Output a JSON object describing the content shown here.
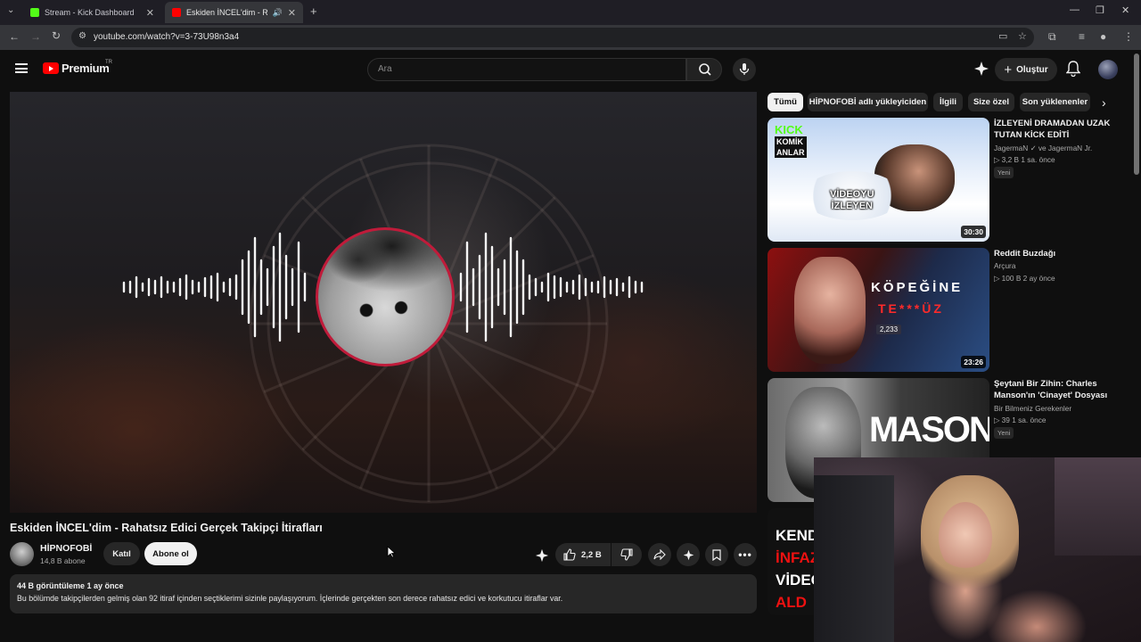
{
  "browser": {
    "tabs": [
      {
        "title": "Stream - Kick Dashboard",
        "favicon_color": "#53fc18"
      },
      {
        "title": "Eskiden İNCEL'dim - Rahatsız Edici Gerçek Takipçi İtirafları",
        "favicon_color": "#ff0000"
      }
    ],
    "url": "youtube.com/watch?v=3-73U98n3a4"
  },
  "header": {
    "logo_text": "Premium",
    "country_code": "TR",
    "search_placeholder": "Ara",
    "create_label": "Oluştur"
  },
  "video": {
    "title": "Eskiden İNCEL'dim - Rahatsız Edici Gerçek Takipçi İtirafları",
    "channel_name": "HİPNOFOBİ",
    "subscribers": "14,8 B abone",
    "join_label": "Katıl",
    "subscribe_label": "Abone ol",
    "like_count": "2,2 B",
    "views_date": "44 B görüntüleme  1 ay önce",
    "description": "Bu bölümde takipçilerden gelmiş olan 92 itiraf içinden seçtiklerimi sizinle paylaşıyorum. İçlerinde gerçekten son derece rahatsız edici ve korkutucu itiraflar var."
  },
  "chips": [
    "Tümü",
    "HİPNOFOBİ adlı yükleyiciden",
    "İlgili",
    "Size özel",
    "Son yüklenenler"
  ],
  "recommendations": [
    {
      "title": "İZLEYENİ DRAMADAN UZAK TUTAN KİCK EDİTİ",
      "channel": "JagermaN ✓ ve JagermaN Jr.",
      "meta": "▷ 3,2 B  1 sa. önce",
      "badge": "Yeni",
      "duration": "30:30",
      "thumb_text_1": "KICK",
      "thumb_text_2": "KOMİK",
      "thumb_text_3": "ANLAR",
      "thumb_text_4": "VİDEOYU",
      "thumb_text_5": "İZLEYEN"
    },
    {
      "title": "Reddit Buzdağı",
      "channel": "Arçura",
      "meta": "▷ 100 B  2 ay önce",
      "duration": "23:26",
      "thumb_text_1": "KÖPEĞİNE",
      "thumb_text_2": "TE***ÜZ",
      "thumb_text_3": "2,233"
    },
    {
      "title": "Şeytani Bir Zihin: Charles Manson'ın 'Cinayet' Dosyası",
      "channel": "Bir Bilmeniz Gerekenler",
      "meta": "▷ 39  1 sa. önce",
      "badge": "Yeni",
      "thumb_text_1": "MASON"
    },
    {
      "thumb_text_1": "KEND",
      "thumb_text_2": "İNFAZ",
      "thumb_text_3": "VİDEO",
      "thumb_text_4": "ALD"
    }
  ],
  "colors": {
    "youtube_red": "#ff0000",
    "kick_green": "#53fc18",
    "ring": "#c01b3a"
  }
}
